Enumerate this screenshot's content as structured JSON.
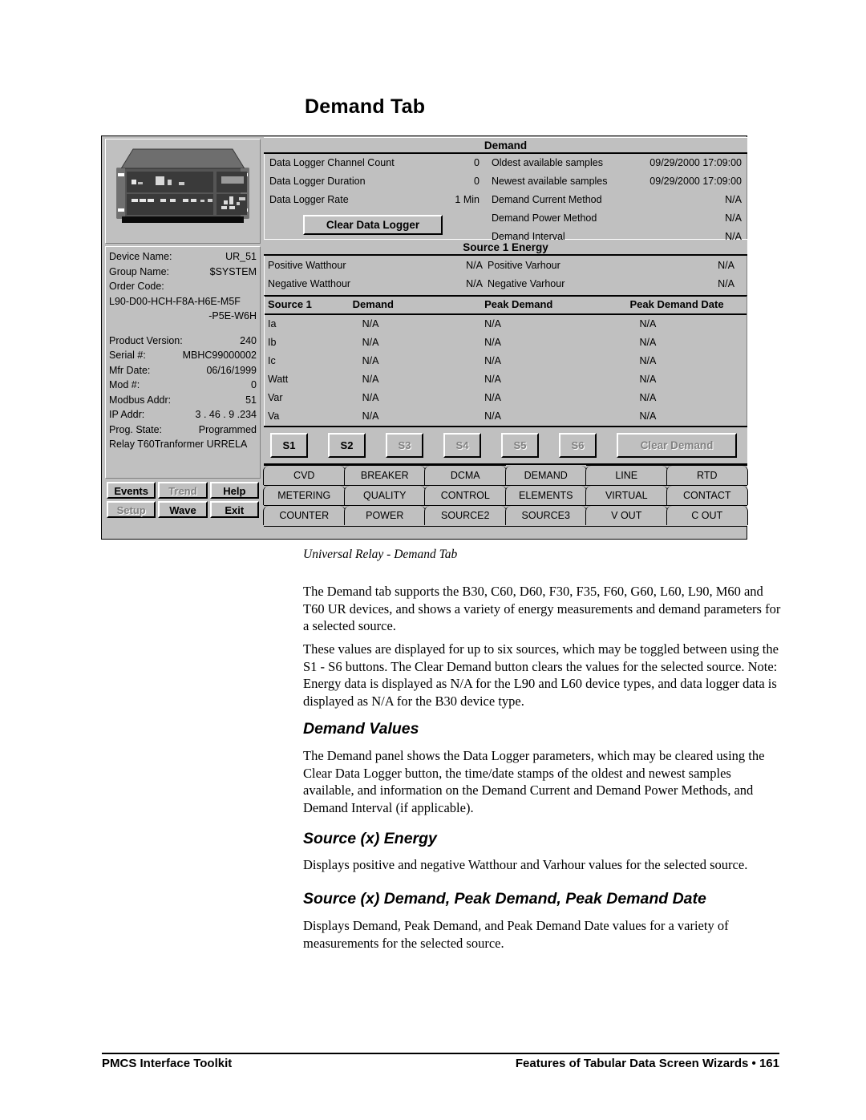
{
  "page": {
    "title": "Demand Tab",
    "caption": "Universal Relay - Demand Tab"
  },
  "screenshot": {
    "device_info": {
      "rows": [
        {
          "label": "Device Name:",
          "value": "UR_51"
        },
        {
          "label": "Group Name:",
          "value": "$SYSTEM"
        },
        {
          "label": "Order Code:",
          "value": ""
        }
      ],
      "order_code_line1": "L90-D00-HCH-F8A-H6E-M5F",
      "order_code_line2": "-P5E-W6H",
      "rows2": [
        {
          "label": "Product Version:",
          "value": "240"
        },
        {
          "label": "Serial #:",
          "value": "MBHC99000002"
        },
        {
          "label": "Mfr Date:",
          "value": "06/16/1999"
        },
        {
          "label": "Mod #:",
          "value": "0"
        },
        {
          "label": "Modbus Addr:",
          "value": "51"
        },
        {
          "label": "IP Addr:",
          "value": "3 . 46 .   9 .234"
        },
        {
          "label": "Prog. State:",
          "value": "Programmed"
        }
      ],
      "footer_line": "Relay T60Tranformer URRELA"
    },
    "left_buttons": [
      {
        "label": "Events",
        "disabled": false
      },
      {
        "label": "Trend",
        "disabled": true
      },
      {
        "label": "Help",
        "disabled": false
      },
      {
        "label": "Setup",
        "disabled": true
      },
      {
        "label": "Wave",
        "disabled": false
      },
      {
        "label": "Exit",
        "disabled": false
      }
    ],
    "demand_panel": {
      "header": "Demand",
      "left_rows": [
        {
          "label": "Data Logger Channel Count",
          "value": "0"
        },
        {
          "label": "Data Logger Duration",
          "value": "0"
        },
        {
          "label": "Data Logger Rate",
          "value": "1 Min"
        }
      ],
      "right_rows": [
        {
          "label": "Oldest available samples",
          "value": "09/29/2000 17:09:00"
        },
        {
          "label": "Newest available samples",
          "value": "09/29/2000 17:09:00"
        },
        {
          "label": "Demand Current Method",
          "value": "N/A"
        },
        {
          "label": "Demand Power Method",
          "value": "N/A"
        },
        {
          "label": "Demand Interval",
          "value": "N/A"
        }
      ],
      "clear_button": "Clear Data Logger"
    },
    "energy_panel": {
      "header": "Source 1 Energy",
      "rows": [
        {
          "label_a": "Positive Watthour",
          "value_a": "N/A",
          "label_b": "Positive Varhour",
          "value_b": "N/A"
        },
        {
          "label_a": "Negative Watthour",
          "value_a": "N/A",
          "label_b": "Negative Varhour",
          "value_b": "N/A"
        }
      ]
    },
    "demand_table": {
      "headers": [
        "Source 1",
        "Demand",
        "Peak Demand",
        "Peak Demand Date"
      ],
      "rows": [
        [
          "Ia",
          "N/A",
          "N/A",
          "N/A"
        ],
        [
          "Ib",
          "N/A",
          "N/A",
          "N/A"
        ],
        [
          "Ic",
          "N/A",
          "N/A",
          "N/A"
        ],
        [
          "Watt",
          "N/A",
          "N/A",
          "N/A"
        ],
        [
          "Var",
          "N/A",
          "N/A",
          "N/A"
        ],
        [
          "Va",
          "N/A",
          "N/A",
          "N/A"
        ]
      ]
    },
    "source_buttons": [
      {
        "label": "S1",
        "disabled": false
      },
      {
        "label": "S2",
        "disabled": false
      },
      {
        "label": "S3",
        "disabled": true
      },
      {
        "label": "S4",
        "disabled": true
      },
      {
        "label": "S5",
        "disabled": true
      },
      {
        "label": "S6",
        "disabled": true
      }
    ],
    "clear_demand_button": "Clear Demand",
    "tabs": [
      [
        "CVD",
        "BREAKER",
        "DCMA",
        "DEMAND",
        "LINE",
        "RTD"
      ],
      [
        "METERING",
        "QUALITY",
        "CONTROL",
        "ELEMENTS",
        "VIRTUAL",
        "CONTACT"
      ],
      [
        "COUNTER",
        "POWER",
        "SOURCE2",
        "SOURCE3",
        "V OUT",
        "C OUT"
      ]
    ],
    "active_tab": "DEMAND"
  },
  "body": {
    "p1": "The Demand tab supports the B30, C60, D60, F30, F35, F60, G60, L60, L90, M60 and T60 UR devices, and shows a variety of energy measurements and demand parameters for a selected source.",
    "p2": "These values are displayed for up to six sources, which may be toggled between using the S1 - S6 buttons. The Clear Demand button clears the values for the selected source. Note: Energy data is displayed as N/A for the L90 and L60 device types, and data logger data is displayed as N/A for the B30 device type.",
    "h1": "Demand Values",
    "p3": "The Demand panel shows the Data Logger parameters, which may be cleared using the Clear Data Logger button, the time/date stamps of the oldest and newest samples available, and information on the Demand Current and Demand Power Methods, and Demand Interval (if applicable).",
    "h2": "Source (x) Energy",
    "p4": "Displays positive and negative Watthour and Varhour values for the selected source.",
    "h3": "Source (x) Demand, Peak Demand, Peak Demand Date",
    "p5": "Displays Demand, Peak Demand, and Peak Demand Date values for a variety of measurements for the selected source."
  },
  "footer": {
    "left": "PMCS Interface Toolkit",
    "right": "Features of Tabular Data Screen Wizards  •  161"
  },
  "colors": {
    "widget_face": "#c0c0c0",
    "shadow": "#808080",
    "highlight": "#ffffff",
    "text": "#000000",
    "disabled_text": "#808080"
  }
}
